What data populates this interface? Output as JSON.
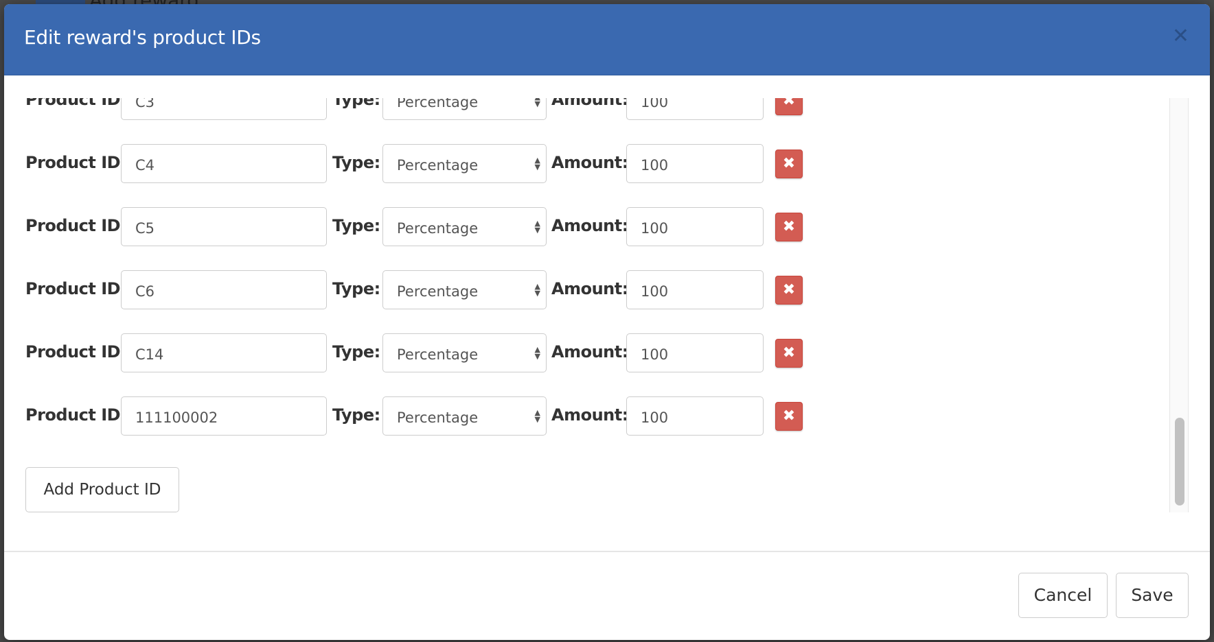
{
  "background": {
    "button_label": "Add reward"
  },
  "modal": {
    "title": "Edit reward's product IDs",
    "close_icon": "close-icon",
    "labels": {
      "product_id": "Product ID:",
      "type": "Type:",
      "amount": "Amount:"
    },
    "rows": [
      {
        "product_id": "C3",
        "type": "Percentage",
        "amount": "100"
      },
      {
        "product_id": "C4",
        "type": "Percentage",
        "amount": "100"
      },
      {
        "product_id": "C5",
        "type": "Percentage",
        "amount": "100"
      },
      {
        "product_id": "C6",
        "type": "Percentage",
        "amount": "100"
      },
      {
        "product_id": "C14",
        "type": "Percentage",
        "amount": "100"
      },
      {
        "product_id": "111100002",
        "type": "Percentage",
        "amount": "100"
      }
    ],
    "add_button": "Add Product ID",
    "cancel_button": "Cancel",
    "save_button": "Save",
    "colors": {
      "header": "#3a69b0",
      "delete": "#d35c53"
    }
  }
}
